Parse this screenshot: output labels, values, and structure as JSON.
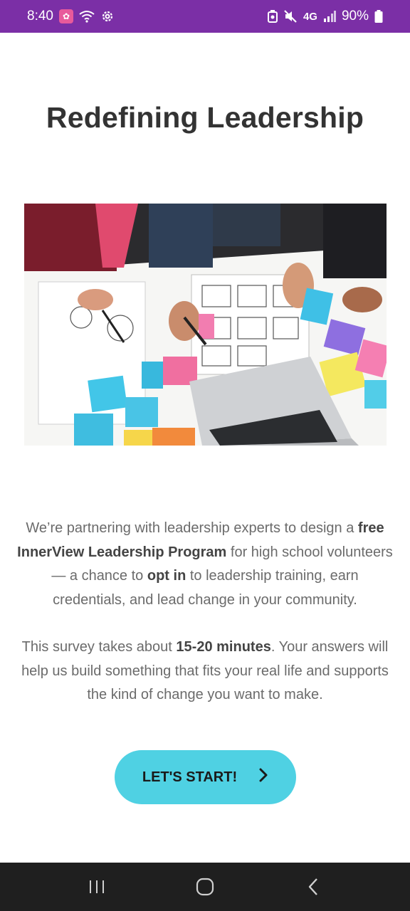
{
  "status_bar": {
    "time": "8:40",
    "network": "4G",
    "battery": "90%",
    "icons": [
      "app-notification-icon",
      "wifi-icon",
      "settings-gear-icon",
      "battery-saver-icon",
      "mute-icon",
      "signal-icon",
      "battery-icon"
    ]
  },
  "page": {
    "title": "Redefining Leadership",
    "image_alt": "people planning with sticky notes and a laptop"
  },
  "intro": {
    "p1_a": "We’re partnering with leadership experts to design a ",
    "p1_b": "free InnerView Leadership Program",
    "p1_c": " for high school volunteers — a chance to ",
    "p1_d": "opt in",
    "p1_e": " to leadership training, earn credentials, and lead change in your community.",
    "p2_a": "This survey takes about ",
    "p2_b": "15-20 minutes",
    "p2_c": ". Your answers will help us build something that fits your real life and supports the kind of change you want to make."
  },
  "cta": {
    "label": "LET'S START!",
    "icon": "chevron-right-icon",
    "background": "#4fd1e3"
  },
  "nav": {
    "buttons": [
      "recent-apps-icon",
      "home-icon",
      "back-icon"
    ]
  },
  "colors": {
    "status_bar": "#7b2fa6",
    "title": "#333333",
    "body_text": "#6b6b6b"
  }
}
